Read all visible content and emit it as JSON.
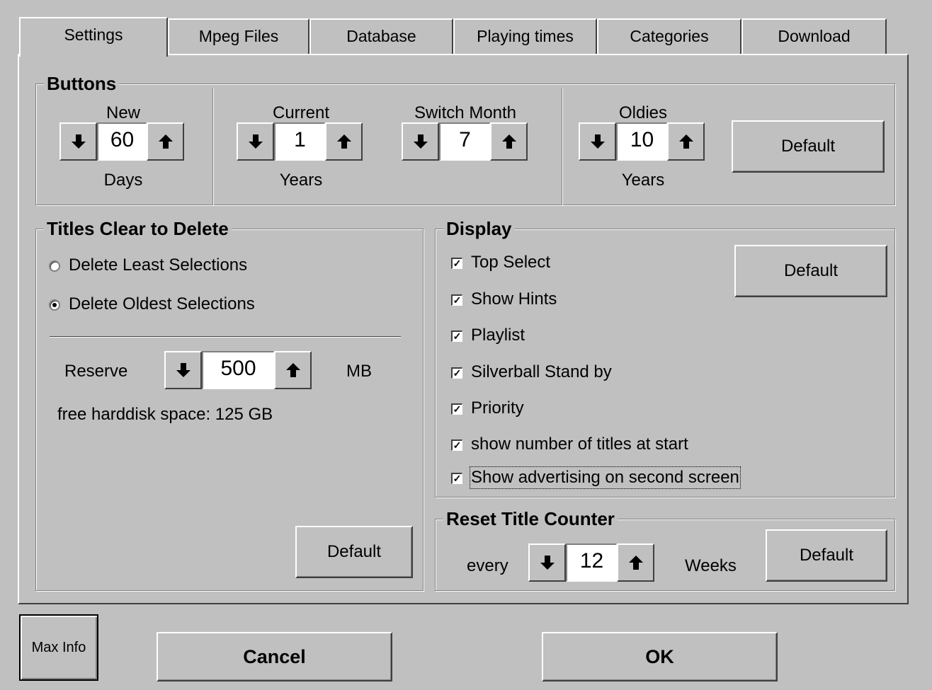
{
  "tabs": [
    "Settings",
    "Mpeg Files",
    "Database",
    "Playing times",
    "Categories",
    "Download"
  ],
  "buttons_group": {
    "title": "Buttons",
    "new": {
      "label": "New",
      "value": "60",
      "unit": "Days"
    },
    "current": {
      "label": "Current",
      "value": "1",
      "unit": "Years"
    },
    "switch_month": {
      "label": "Switch Month",
      "value": "7"
    },
    "oldies": {
      "label": "Oldies",
      "value": "10",
      "unit": "Years"
    },
    "default_label": "Default"
  },
  "titles_clear": {
    "title": "Titles Clear to Delete",
    "options": [
      {
        "label": "Delete Least Selections",
        "selected": false
      },
      {
        "label": "Delete Oldest Selections",
        "selected": true
      }
    ],
    "reserve_label": "Reserve",
    "reserve_value": "500",
    "reserve_unit": "MB",
    "free_space": "free harddisk space: 125 GB",
    "default_label": "Default"
  },
  "display": {
    "title": "Display",
    "items": [
      {
        "label": "Top Select",
        "checked": true
      },
      {
        "label": "Show Hints",
        "checked": true
      },
      {
        "label": "Playlist",
        "checked": true
      },
      {
        "label": "Silverball Stand by",
        "checked": true
      },
      {
        "label": "Priority",
        "checked": true
      },
      {
        "label": "show number of titles at start",
        "checked": true
      },
      {
        "label": "Show advertising on second screen",
        "checked": true
      }
    ],
    "default_label": "Default"
  },
  "reset_counter": {
    "title": "Reset Title Counter",
    "every_label": "every",
    "value": "12",
    "unit": "Weeks",
    "default_label": "Default"
  },
  "footer": {
    "max_info": "Max Info",
    "cancel": "Cancel",
    "ok": "OK"
  },
  "colors": {
    "face": "#c0c0c0",
    "highlight": "#ffffff",
    "shadow": "#808080",
    "dark_shadow": "#404040"
  }
}
